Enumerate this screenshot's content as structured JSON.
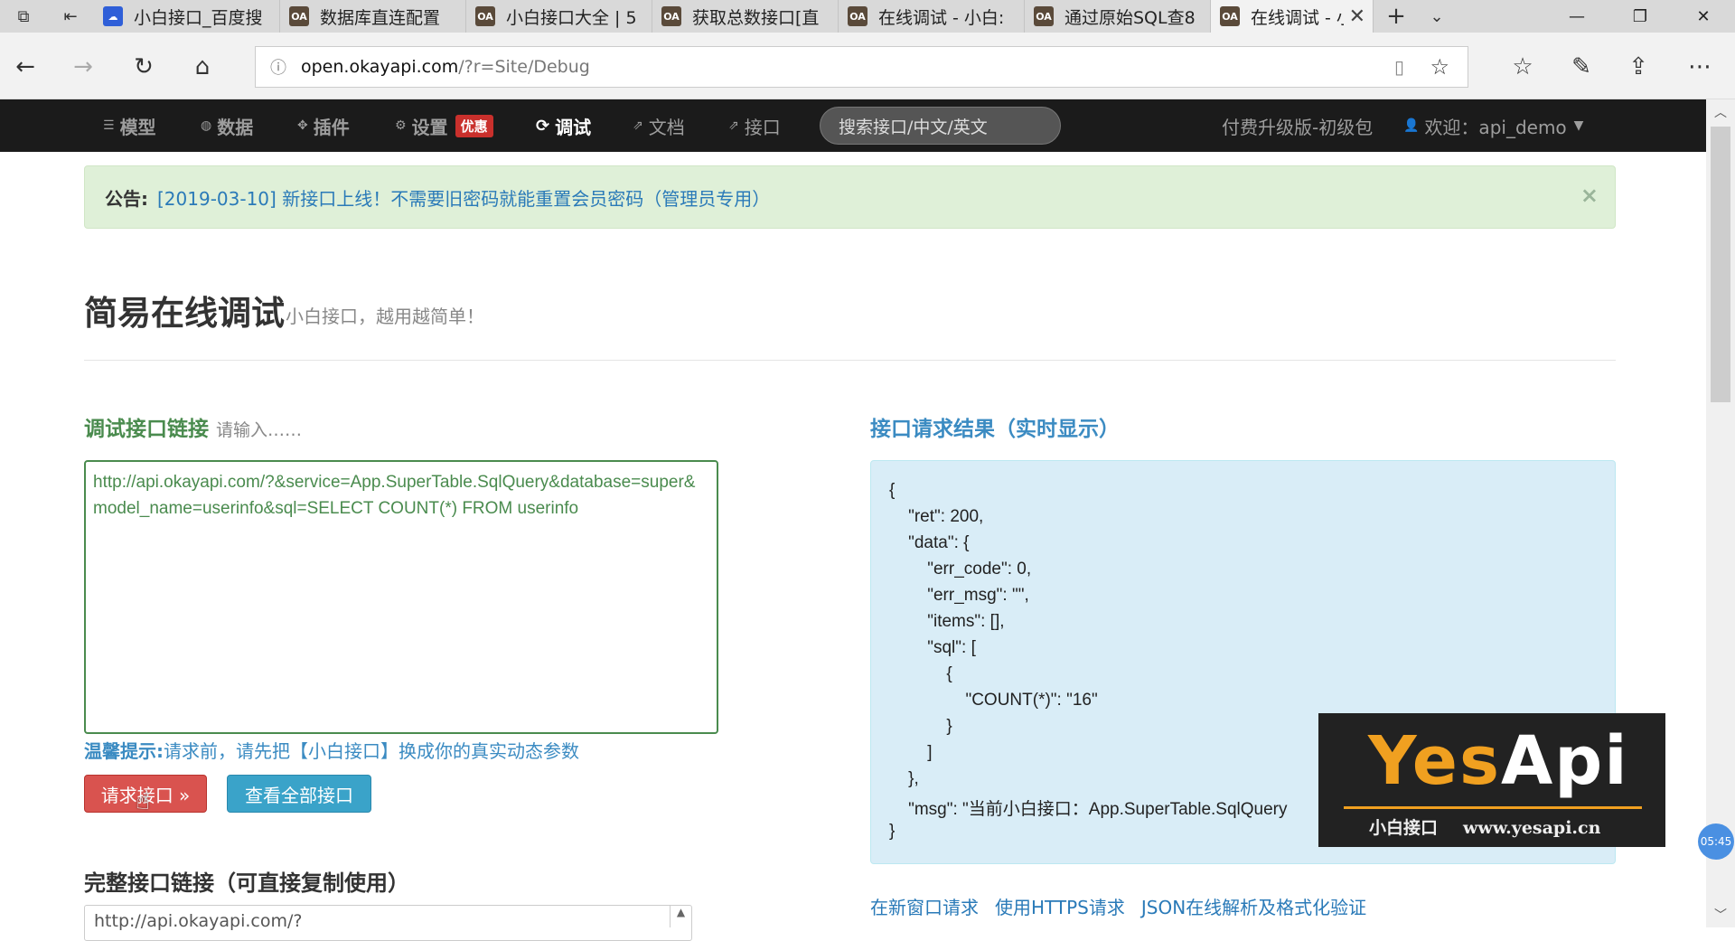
{
  "browser": {
    "tabs": [
      {
        "title": "小白接口_百度搜",
        "favicon": "baidu"
      },
      {
        "title": "数据库直连配置",
        "favicon": "oa"
      },
      {
        "title": "小白接口大全 | 5",
        "favicon": "oa"
      },
      {
        "title": "获取总数接口[直",
        "favicon": "oa"
      },
      {
        "title": "在线调试 - 小白:",
        "favicon": "oa"
      },
      {
        "title": "通过原始SQL查8",
        "favicon": "oa"
      },
      {
        "title": "在线调试 - 小",
        "favicon": "oa",
        "active": true
      }
    ],
    "favicon_text": "OA",
    "url_host": "open.okayapi.com",
    "url_path": "/?r=Site/Debug"
  },
  "sitenav": {
    "items": [
      "模型",
      "数据",
      "插件",
      "设置",
      "调试",
      "文档",
      "接口"
    ],
    "hot_badge": "优惠",
    "search_placeholder": "搜索接口/中文/英文",
    "upgrade": "付费升级版-初级包",
    "user": "欢迎：api_demo"
  },
  "notice": {
    "label": "公告:",
    "text": "[2019-03-10] 新接口上线！不需要旧密码就能重置会员密码（管理员专用）"
  },
  "page": {
    "title": "简易在线调试",
    "subtitle": "小白接口，越用越简单！"
  },
  "debug": {
    "title": "调试接口链接",
    "hint": "请输入……",
    "url": "http://api.okayapi.com/?&service=App.SuperTable.SqlQuery&database=super&model_name=userinfo&sql=SELECT COUNT(*) FROM userinfo",
    "tip_label": "温馨提示:",
    "tip_text": "请求前，请先把【小白接口】换成你的真实动态参数",
    "request_button": "请求接口 »",
    "view_all_button": "查看全部接口",
    "full_title": "完整接口链接（可直接复制使用）",
    "full_url": "http://api.okayapi.com/?"
  },
  "result": {
    "title": "接口请求结果（实时显示）",
    "lines": [
      "{",
      "    \"ret\": 200,",
      "    \"data\": {",
      "        \"err_code\": 0,",
      "        \"err_msg\": \"\",",
      "        \"items\": [],",
      "        \"sql\": [",
      "            {",
      "                \"COUNT(*)\": \"16\"",
      "            }",
      "        ]",
      "    },",
      "    \"msg\": \"当前小白接口：App.SuperTable.SqlQuery",
      "}"
    ],
    "links": [
      "在新窗口请求",
      "使用HTTPS请求",
      "JSON在线解析及格式化验证"
    ]
  },
  "watermark": {
    "brand_left": "Yes",
    "brand_right": "Api",
    "tagline": "小白接口",
    "site": "www.yesapi.cn"
  },
  "clock": "05:45"
}
